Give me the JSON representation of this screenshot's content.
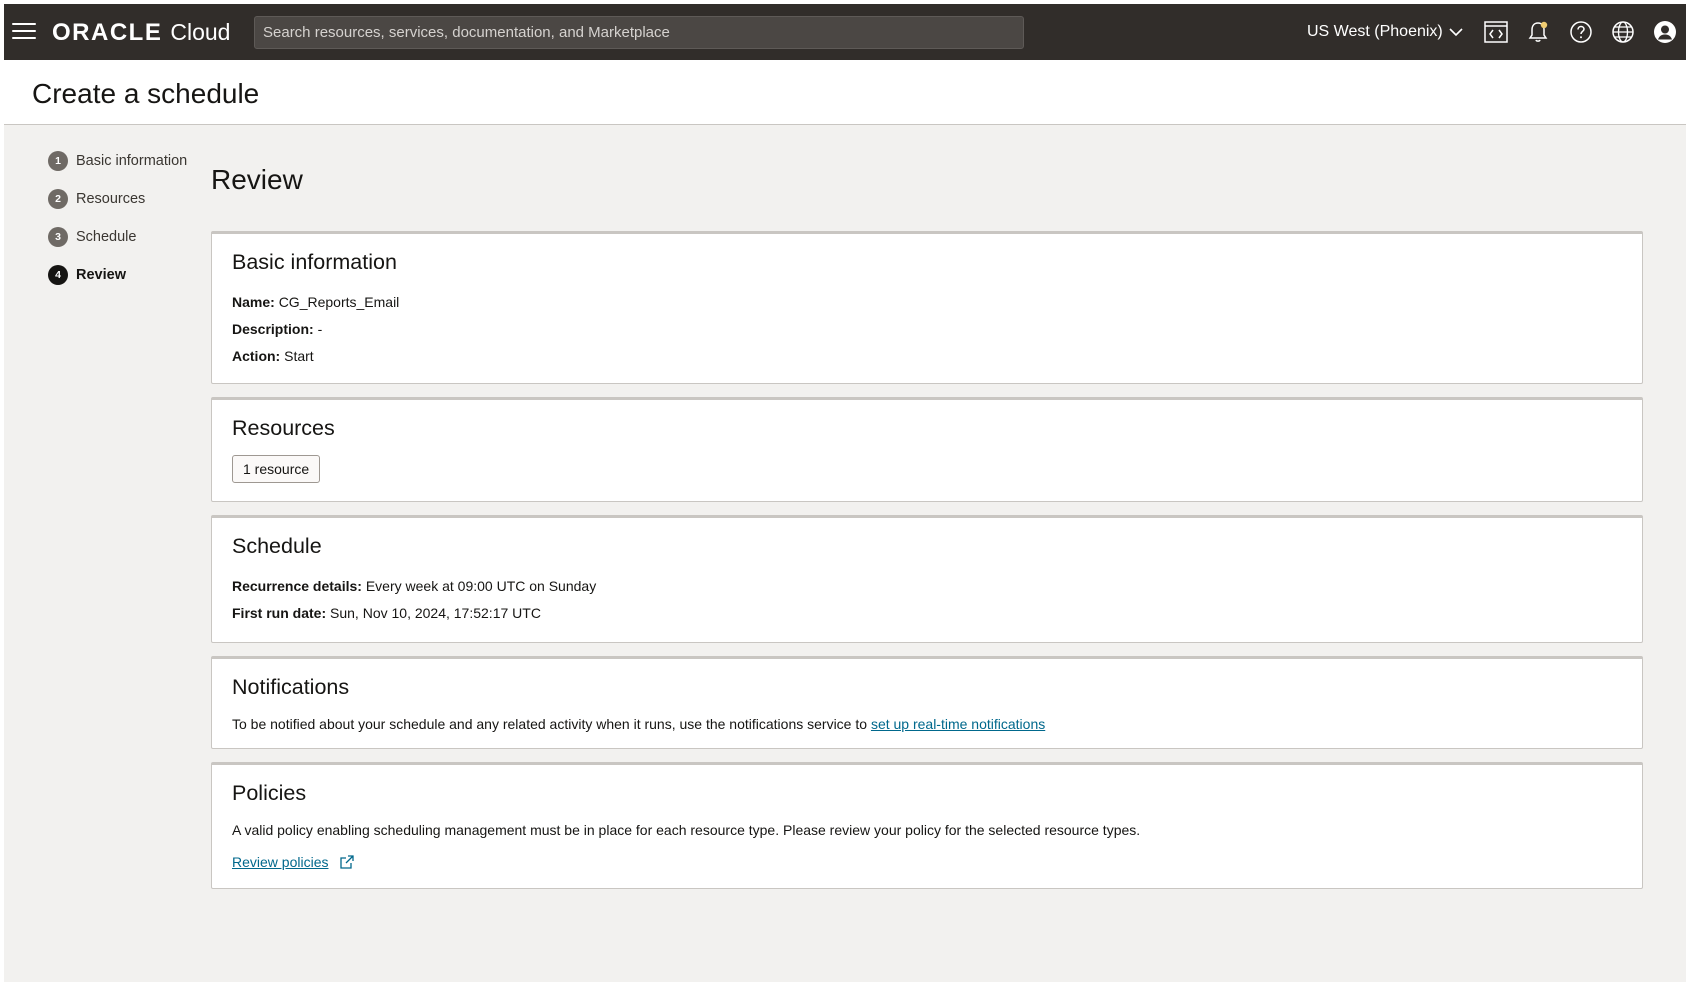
{
  "topbar": {
    "brand_oracle": "ORACLE",
    "brand_cloud": "Cloud",
    "search_placeholder": "Search resources, services, documentation, and Marketplace",
    "region": "US West (Phoenix)",
    "icons": [
      "menu-icon",
      "code-editor-icon",
      "bell-icon",
      "help-icon",
      "globe-icon",
      "user-icon"
    ],
    "notification_dot_color": "#f0cc71"
  },
  "page": {
    "title": "Create a schedule"
  },
  "steps": [
    {
      "num": "1",
      "label": "Basic information",
      "active": false
    },
    {
      "num": "2",
      "label": "Resources",
      "active": false
    },
    {
      "num": "3",
      "label": "Schedule",
      "active": false
    },
    {
      "num": "4",
      "label": "Review",
      "active": true
    }
  ],
  "review": {
    "title": "Review",
    "basic": {
      "heading": "Basic information",
      "name_label": "Name:",
      "name_value": "CG_Reports_Email",
      "description_label": "Description:",
      "description_value": "-",
      "action_label": "Action:",
      "action_value": "Start"
    },
    "resources": {
      "heading": "Resources",
      "count_badge": "1 resource"
    },
    "schedule": {
      "heading": "Schedule",
      "recurrence_label": "Recurrence details:",
      "recurrence_value": "Every week at 09:00 UTC on Sunday",
      "first_run_label": "First run date:",
      "first_run_value": "Sun, Nov 10, 2024, 17:52:17 UTC"
    },
    "notifications": {
      "heading": "Notifications",
      "text": "To be notified about your schedule and any related activity when it runs, use the notifications service to",
      "link": "set up real-time notifications"
    },
    "policies": {
      "heading": "Policies",
      "text": "A valid policy enabling scheduling management must be in place for each resource type. Please review your policy for the selected resource types.",
      "link": "Review policies"
    }
  },
  "colors": {
    "topbar_bg": "#312d2a",
    "page_bg": "#f2f1ef",
    "link": "#00688c",
    "step_active": "#161513",
    "step_inactive": "#6f6a65"
  }
}
